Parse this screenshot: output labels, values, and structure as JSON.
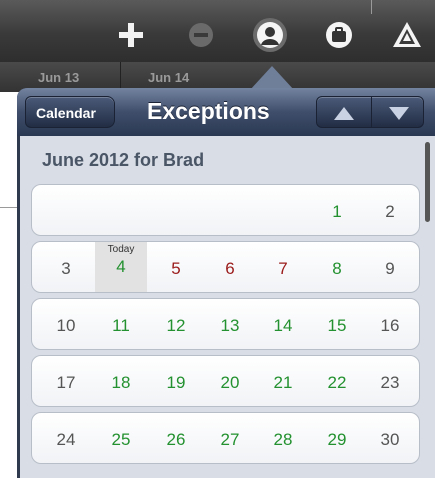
{
  "toolbar": {
    "icons": [
      "plus-icon",
      "minus-circle-icon",
      "person-icon",
      "briefcase-icon",
      "warning-icon"
    ]
  },
  "date_strip": {
    "labels": [
      "Jun 13",
      "Jun 14"
    ]
  },
  "popover": {
    "back_label": "Calendar",
    "title": "Exceptions",
    "nav": [
      "previous-arrow",
      "next-arrow"
    ]
  },
  "calendar": {
    "month_title": "June 2012 for Brad",
    "today_label": "Today",
    "colors": {
      "available": "#23912f",
      "exception": "#9b1b1b",
      "weekend": "#555555"
    },
    "weeks": [
      [
        {
          "d": ""
        },
        {
          "d": ""
        },
        {
          "d": ""
        },
        {
          "d": ""
        },
        {
          "d": ""
        },
        {
          "d": "1",
          "s": "green"
        },
        {
          "d": "2",
          "s": "gray"
        }
      ],
      [
        {
          "d": "3",
          "s": "gray"
        },
        {
          "d": "4",
          "s": "green",
          "today": true
        },
        {
          "d": "5",
          "s": "red"
        },
        {
          "d": "6",
          "s": "red"
        },
        {
          "d": "7",
          "s": "red"
        },
        {
          "d": "8",
          "s": "green"
        },
        {
          "d": "9",
          "s": "gray"
        }
      ],
      [
        {
          "d": "10",
          "s": "gray"
        },
        {
          "d": "11",
          "s": "green"
        },
        {
          "d": "12",
          "s": "green"
        },
        {
          "d": "13",
          "s": "green"
        },
        {
          "d": "14",
          "s": "green"
        },
        {
          "d": "15",
          "s": "green"
        },
        {
          "d": "16",
          "s": "gray"
        }
      ],
      [
        {
          "d": "17",
          "s": "gray"
        },
        {
          "d": "18",
          "s": "green"
        },
        {
          "d": "19",
          "s": "green"
        },
        {
          "d": "20",
          "s": "green"
        },
        {
          "d": "21",
          "s": "green"
        },
        {
          "d": "22",
          "s": "green"
        },
        {
          "d": "23",
          "s": "gray"
        }
      ],
      [
        {
          "d": "24",
          "s": "gray"
        },
        {
          "d": "25",
          "s": "green"
        },
        {
          "d": "26",
          "s": "green"
        },
        {
          "d": "27",
          "s": "green"
        },
        {
          "d": "28",
          "s": "green"
        },
        {
          "d": "29",
          "s": "green"
        },
        {
          "d": "30",
          "s": "gray"
        }
      ]
    ]
  }
}
